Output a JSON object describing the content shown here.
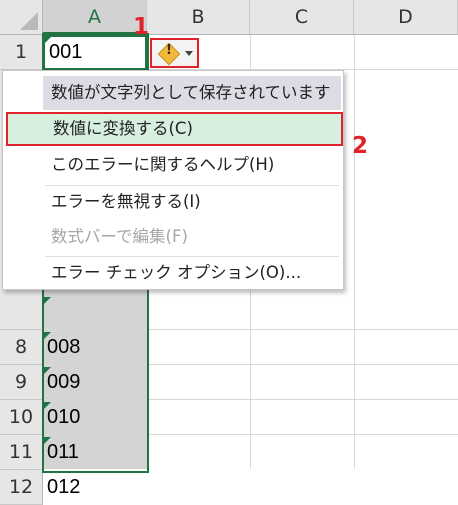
{
  "columns": [
    "A",
    "B",
    "C",
    "D"
  ],
  "rows": [
    "1",
    "8",
    "9",
    "10",
    "11",
    "12"
  ],
  "cells": {
    "a1": "001",
    "a8": "008",
    "a9": "009",
    "a10": "010",
    "a11": "011",
    "a12": "012"
  },
  "error_button": {
    "icon": "warning-diamond-icon",
    "glyph": "!"
  },
  "steps": {
    "one": "1",
    "two": "2"
  },
  "menu": {
    "header": "数値が文字列として保存されています",
    "convert": "数値に変換する(C)",
    "help": "このエラーに関するヘルプ(H)",
    "ignore": "エラーを無視する(I)",
    "edit_in_bar": "数式バーで編集(F)",
    "options": "エラー チェック オプション(O)..."
  },
  "colors": {
    "accent": "#217346",
    "highlight_border": "#e0222a",
    "highlight_fill": "#d6efdf",
    "selected_column": "#d4d4d4"
  }
}
